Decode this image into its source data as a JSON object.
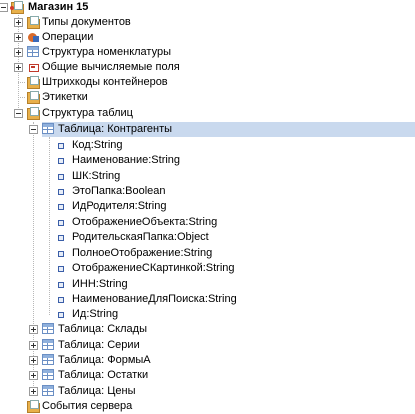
{
  "tree": {
    "root_label": "Магазин 15",
    "top_items": [
      "Типы документов",
      "Операции",
      "Структура номенклатуры",
      "Общие вычисляемые поля",
      "Штрихкоды контейнеров",
      "Этикетки",
      "Структура таблиц"
    ],
    "selected_table": "Таблица: Контрагенты",
    "fields": [
      "Код:String",
      "Наименование:String",
      "ШК:String",
      "ЭтоПапка:Boolean",
      "ИдРодителя:String",
      "ОтображениеОбъекта:String",
      "РодительскаяПапка:Object",
      "ПолноеОтображение:String",
      "ОтображениеСКартинкой:String",
      "ИНН:String",
      "НаименованиеДляПоиска:String",
      "Ид:String"
    ],
    "other_tables": [
      "Таблица: Склады",
      "Таблица: Серии",
      "Таблица: ФормыА",
      "Таблица: Остатки",
      "Таблица: Цены"
    ],
    "last_item": "События сервера"
  }
}
